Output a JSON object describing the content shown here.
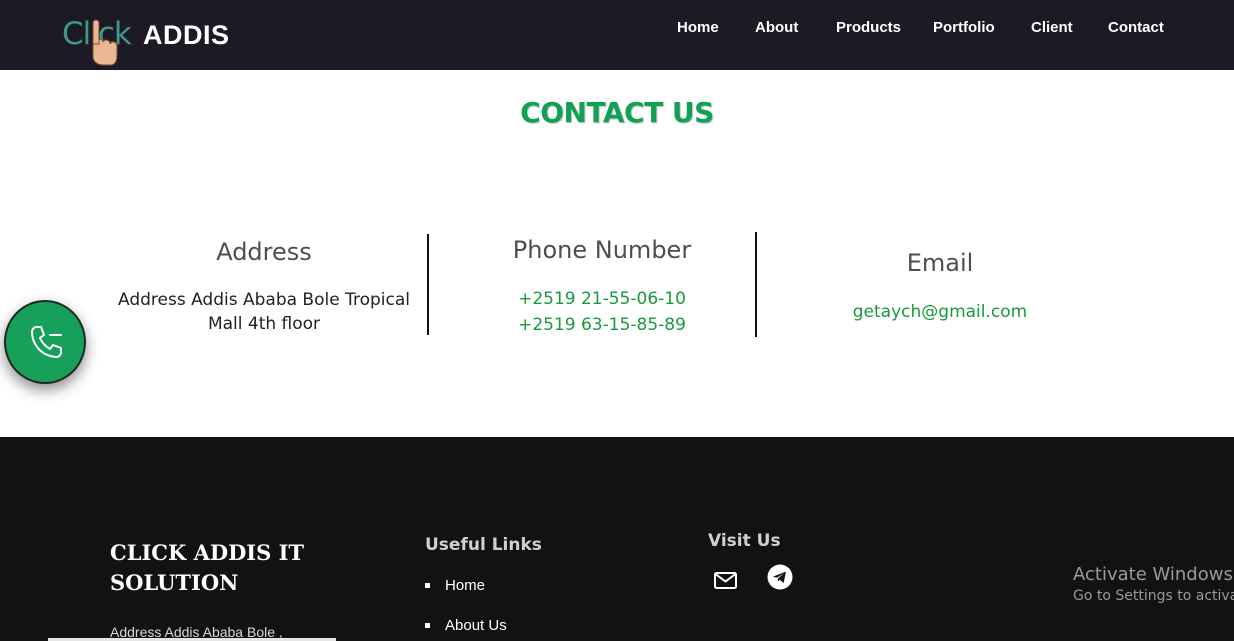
{
  "brand": {
    "logo_click": "Click",
    "logo_addis": "ADDIS"
  },
  "nav": {
    "items": [
      {
        "label": "Home"
      },
      {
        "label": "About"
      },
      {
        "label": "Products"
      },
      {
        "label": "Portfolio"
      },
      {
        "label": "Client"
      },
      {
        "label": "Contact"
      }
    ]
  },
  "contact": {
    "title": "CONTACT US",
    "address": {
      "heading": "Address",
      "line1": "Address Addis Ababa Bole Tropical",
      "line2": "Mall 4th floor"
    },
    "phone": {
      "heading": "Phone Number",
      "numbers": [
        "+2519 21-55-06-10",
        "+2519 63-15-85-89"
      ]
    },
    "email": {
      "heading": "Email",
      "value": "getaych@gmail.com"
    }
  },
  "fab": {
    "icon": "phone-icon",
    "color": "#16a05a"
  },
  "footer": {
    "brand_line1": "CLICK ADDIS IT",
    "brand_line2": "SOLUTION",
    "address": "Address Addis Ababa Bole ,",
    "useful_links_heading": "Useful Links",
    "useful_links": [
      {
        "label": "Home"
      },
      {
        "label": "About Us"
      }
    ],
    "visit_heading": "Visit Us",
    "social": [
      {
        "icon": "mail-icon"
      },
      {
        "icon": "telegram-icon"
      }
    ]
  },
  "watermark": {
    "line1": "Activate Windows",
    "line2": "Go to Settings to activat"
  },
  "colors": {
    "accent_green": "#10a154",
    "nav_bg": "#1b1a25",
    "footer_bg": "#121212"
  }
}
